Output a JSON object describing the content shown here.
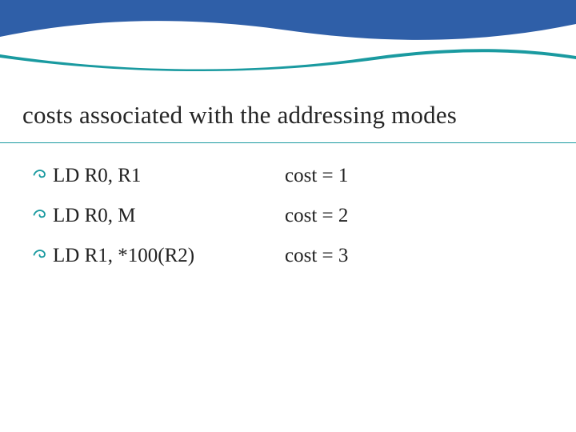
{
  "title": "costs associated with the addressing modes",
  "items": [
    {
      "lhs": "LD R0, R1",
      "rhs": "cost = 1"
    },
    {
      "lhs": "LD R0, M",
      "rhs": "cost = 2"
    },
    {
      "lhs": "LD R1, *100(R2)",
      "rhs": "cost = 3"
    }
  ],
  "colors": {
    "blue": "#2f5fa8",
    "teal": "#1a9aa0",
    "white": "#ffffff"
  }
}
